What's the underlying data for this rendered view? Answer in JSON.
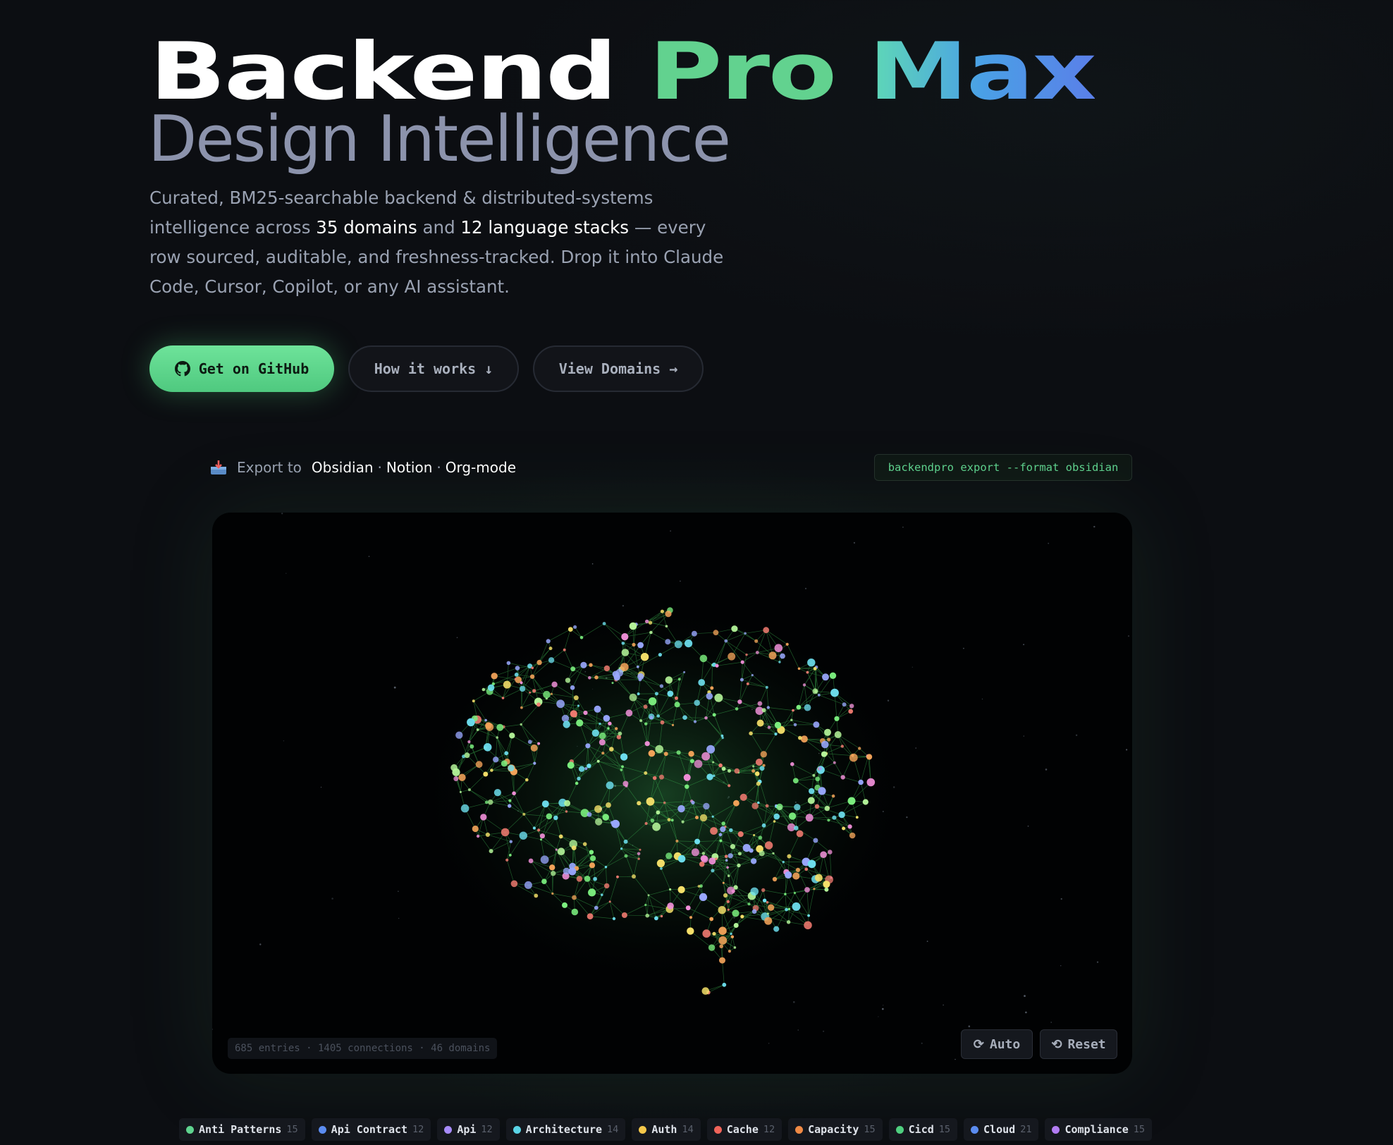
{
  "hero": {
    "title_word1": "Backend",
    "title_word2": "Pro",
    "title_word3": "Max",
    "subtitle": "Design Intelligence",
    "desc_1": "Curated, BM25-searchable backend & distributed-systems intelligence across ",
    "desc_domains": "35 domains",
    "desc_2": " and ",
    "desc_stacks": "12 language stacks",
    "desc_3": " — every row sourced, auditable, and freshness-tracked. Drop it into Claude Code, Cursor, Copilot, or any AI assistant."
  },
  "buttons": {
    "github": "Get on GitHub",
    "how": "How it works ↓",
    "view": "View Domains →"
  },
  "export": {
    "label": "Export to",
    "target1": "Obsidian",
    "target2": "Notion",
    "target3": "Org-mode",
    "sep": "·",
    "command": "backendpro export --format obsidian"
  },
  "graph": {
    "stats": "685 entries · 1405 connections · 46 domains",
    "auto_label": "Auto",
    "reset_label": "Reset"
  },
  "domains": [
    {
      "name": "Anti Patterns",
      "count": "15",
      "color": "#5fd38f"
    },
    {
      "name": "Api Contract",
      "count": "12",
      "color": "#5b8cf0"
    },
    {
      "name": "Api",
      "count": "12",
      "color": "#a78bfa"
    },
    {
      "name": "Architecture",
      "count": "14",
      "color": "#5ad4e6"
    },
    {
      "name": "Auth",
      "count": "14",
      "color": "#f5c84a"
    },
    {
      "name": "Cache",
      "count": "12",
      "color": "#f0645a"
    },
    {
      "name": "Capacity",
      "count": "15",
      "color": "#f08a45"
    },
    {
      "name": "Cicd",
      "count": "15",
      "color": "#4fcf7f"
    },
    {
      "name": "Cloud",
      "count": "21",
      "color": "#5b8cf0"
    },
    {
      "name": "Compliance",
      "count": "15",
      "color": "#b27cf2"
    }
  ],
  "colors": {
    "accent_green": "#5fd38f",
    "node_palette": [
      "#7cf07f",
      "#f5e06a",
      "#6ee0f0",
      "#f08fd8",
      "#9aa8ff",
      "#f5a45a",
      "#f07a70",
      "#b5f59a"
    ]
  }
}
